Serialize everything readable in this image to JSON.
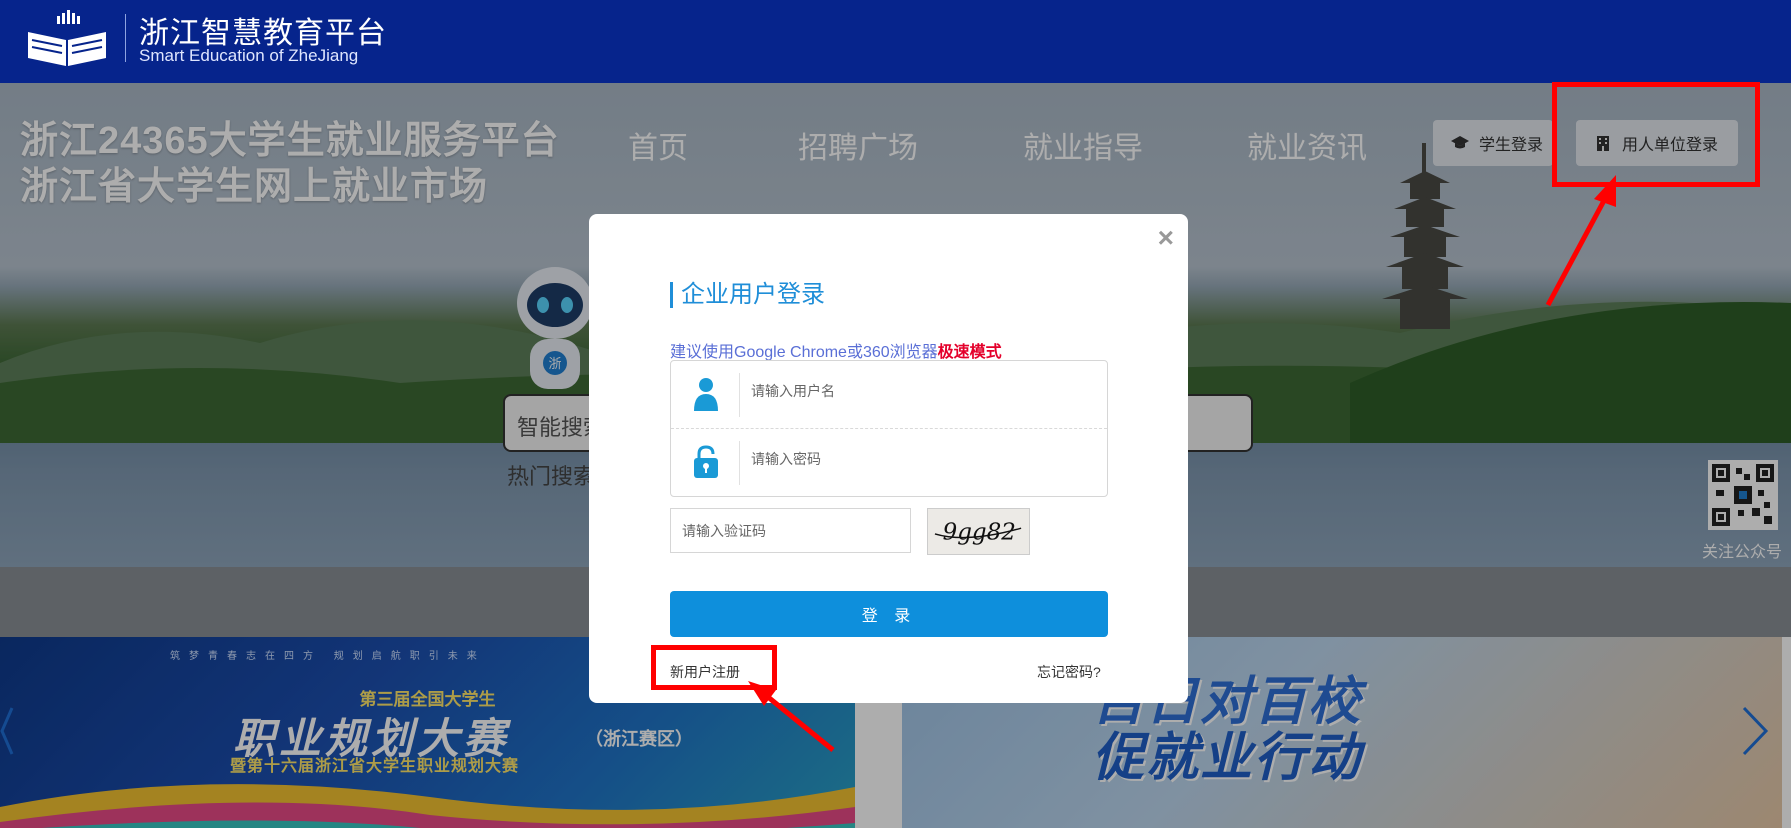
{
  "header": {
    "title": "浙江智慧教育平台",
    "subtitle": "Smart Education of ZheJiang"
  },
  "hero": {
    "title_line1": "浙江24365大学生就业服务平台",
    "title_line2": "浙江省大学生网上就业市场",
    "nav": [
      "首页",
      "招聘广场",
      "就业指导",
      "就业资讯"
    ],
    "student_login": "学生登录",
    "employer_login": "用人单位登录",
    "search_label": "智能搜索",
    "hot_search": "热门搜索",
    "qr_label": "关注公众号",
    "robot_badge": "浙"
  },
  "banners": {
    "left_small": "筑梦青春志在四方 规划启航职引未来",
    "left_line1": "第三届全国大学生",
    "left_line2": "职业规划大赛",
    "left_line2_suffix": "（浙江赛区）",
    "left_line3": "暨第十六届浙江省大学生职业规划大赛",
    "right_line1": "百日对百校",
    "right_line2": "促就业行动"
  },
  "modal": {
    "title": "企业用户登录",
    "hint_prefix": "建议使用Google Chrome或360浏览器",
    "hint_mode": "极速模式",
    "username_placeholder": "请输入用户名",
    "password_placeholder": "请输入密码",
    "captcha_placeholder": "请输入验证码",
    "captcha_text": "9gg82",
    "submit_label": "登 录",
    "register_link": "新用户注册",
    "forgot_link": "忘记密码?",
    "close_symbol": "×"
  },
  "colors": {
    "header_bg": "#06248c",
    "primary": "#0e8fdc",
    "title_blue": "#1f8ed8",
    "hint_blue": "#5a6fd6",
    "hint_red": "#e4002b",
    "annotation_red": "#ff0000"
  },
  "icons": [
    "book-logo-icon",
    "graduation-cap-icon",
    "building-icon",
    "user-icon",
    "lock-icon",
    "qr-code-icon",
    "chevron-right-icon",
    "chevron-left-icon",
    "close-icon"
  ]
}
